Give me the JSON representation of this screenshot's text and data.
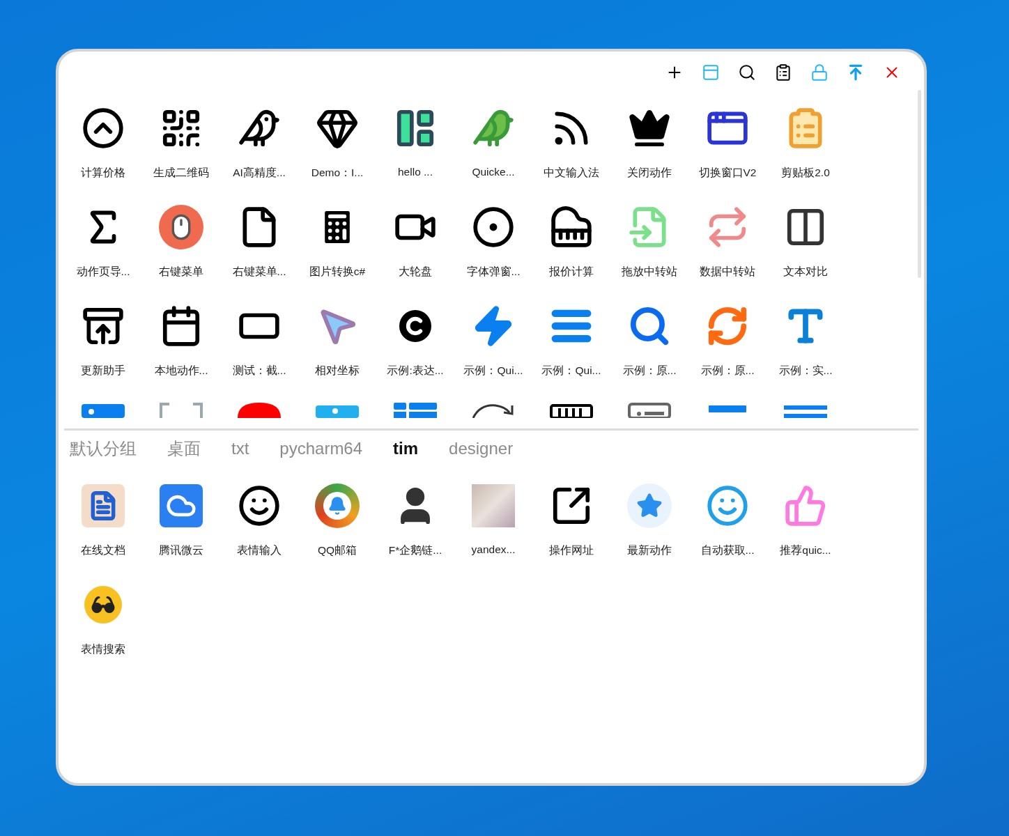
{
  "actions": [
    {
      "label": "计算价格"
    },
    {
      "label": "生成二维码"
    },
    {
      "label": "AI高精度..."
    },
    {
      "label": "Demo：I..."
    },
    {
      "label": "hello ..."
    },
    {
      "label": "Quicke..."
    },
    {
      "label": "中文输入法"
    },
    {
      "label": "关闭动作"
    },
    {
      "label": "切换窗口V2"
    },
    {
      "label": "剪贴板2.0"
    },
    {
      "label": "动作页导..."
    },
    {
      "label": "右键菜单"
    },
    {
      "label": "右键菜单..."
    },
    {
      "label": "图片转换c#"
    },
    {
      "label": "大轮盘"
    },
    {
      "label": "字体弹窗..."
    },
    {
      "label": "报价计算"
    },
    {
      "label": "拖放中转站"
    },
    {
      "label": "数据中转站"
    },
    {
      "label": "文本对比"
    },
    {
      "label": "更新助手"
    },
    {
      "label": "本地动作..."
    },
    {
      "label": "测试：截..."
    },
    {
      "label": "相对坐标"
    },
    {
      "label": "示例:表达..."
    },
    {
      "label": "示例：Qui..."
    },
    {
      "label": "示例：Qui..."
    },
    {
      "label": "示例：原..."
    },
    {
      "label": "示例：原..."
    },
    {
      "label": "示例：实..."
    }
  ],
  "tabs": [
    {
      "label": "默认分组",
      "selected": false
    },
    {
      "label": "桌面",
      "selected": false
    },
    {
      "label": "txt",
      "selected": false
    },
    {
      "label": "pycharm64",
      "selected": false
    },
    {
      "label": "tim",
      "selected": true
    },
    {
      "label": "designer",
      "selected": false
    }
  ],
  "group_items": [
    {
      "label": "在线文档"
    },
    {
      "label": "腾讯微云"
    },
    {
      "label": "表情输入"
    },
    {
      "label": "QQ邮箱"
    },
    {
      "label": "F*企鹅链..."
    },
    {
      "label": "yandex..."
    },
    {
      "label": "操作网址"
    },
    {
      "label": "最新动作"
    },
    {
      "label": "自动获取..."
    },
    {
      "label": "推荐quic..."
    },
    {
      "label": "表情搜索"
    }
  ]
}
